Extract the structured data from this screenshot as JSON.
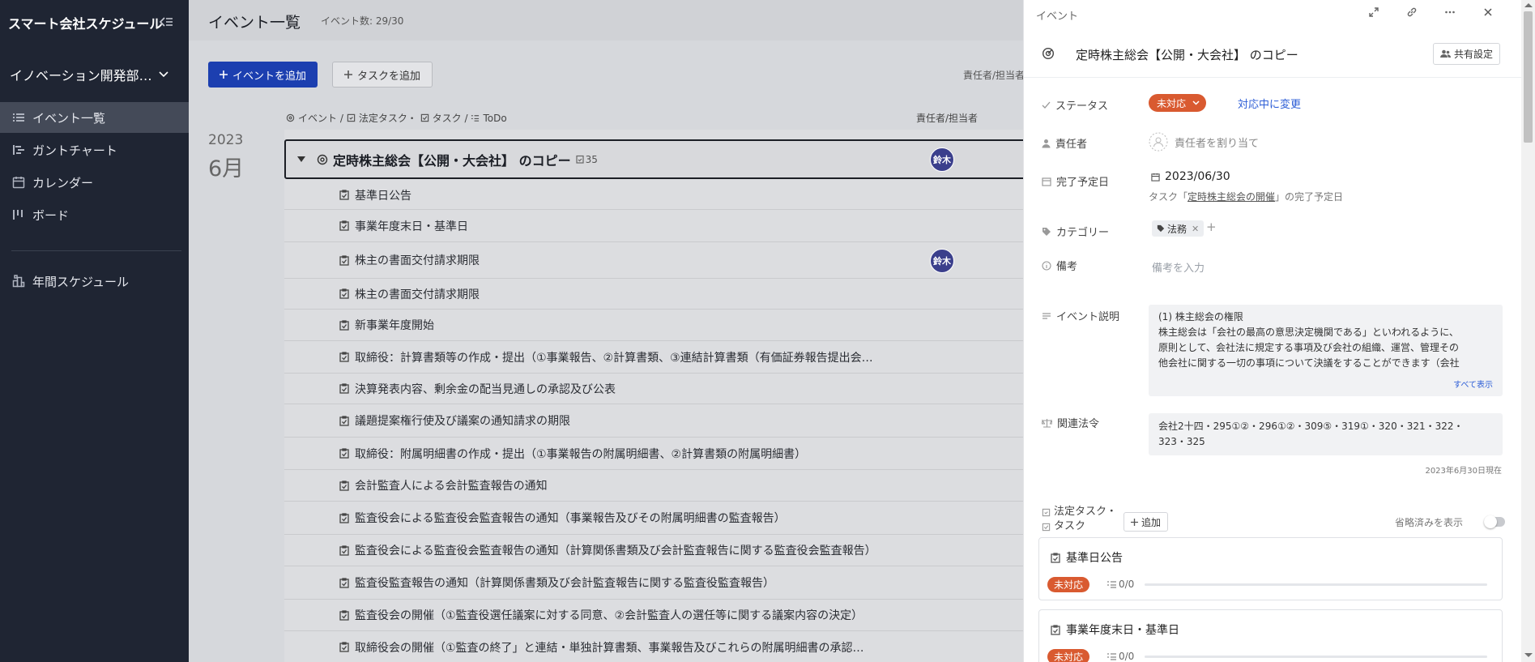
{
  "app": {
    "title": "スマート会社スケジュール",
    "org_name": "イノベーション開発部…"
  },
  "sidebar": {
    "items": [
      {
        "label": "イベント一覧",
        "icon": "list-icon",
        "active": true
      },
      {
        "label": "ガントチャート",
        "icon": "gantt-icon",
        "active": false
      },
      {
        "label": "カレンダー",
        "icon": "calendar-icon",
        "active": false
      },
      {
        "label": "ボード",
        "icon": "board-icon",
        "active": false
      },
      {
        "label": "年間スケジュール",
        "icon": "annual-schedule-icon",
        "active": false
      }
    ]
  },
  "main": {
    "title": "イベント一覧",
    "event_count": "イベント数: 29/30",
    "add_event_label": "イベントを追加",
    "add_task_label": "タスクを追加",
    "assignee_header_cut": "責任者/担当者",
    "list_header": {
      "event": "イベント /",
      "legal_task": "法定タスク・",
      "task": "タスク /",
      "todo": "ToDo",
      "assignee": "責任者/担当者"
    },
    "year": "2023",
    "month": "6月",
    "parent_event": {
      "title": "定時株主総会【公開・大会社】 のコピー",
      "count": "35",
      "avatar": "鈴木"
    },
    "tasks": [
      {
        "label": "基準日公告",
        "avatar": ""
      },
      {
        "label": "事業年度末日・基準日",
        "avatar": ""
      },
      {
        "label": "株主の書面交付請求期限",
        "avatar": "鈴木"
      },
      {
        "label": "株主の書面交付請求期限",
        "avatar": ""
      },
      {
        "label": "新事業年度開始",
        "avatar": ""
      },
      {
        "label": "取締役：計算書類等の作成・提出（①事業報告、②計算書類、③連結計算書類（有価証券報告提出会…",
        "avatar": ""
      },
      {
        "label": "決算発表内容、剰余金の配当見通しの承認及び公表",
        "avatar": ""
      },
      {
        "label": "議題提案権行使及び議案の通知請求の期限",
        "avatar": ""
      },
      {
        "label": "取締役：附属明細書の作成・提出（①事業報告の附属明細書、②計算書類の附属明細書）",
        "avatar": ""
      },
      {
        "label": "会計監査人による会計監査報告の通知",
        "avatar": ""
      },
      {
        "label": "監査役会による監査役会監査報告の通知（事業報告及びその附属明細書の監査報告）",
        "avatar": ""
      },
      {
        "label": "監査役会による監査役会監査報告の通知（計算関係書類及び会計監査報告に関する監査役会監査報告）",
        "avatar": ""
      },
      {
        "label": "監査役監査報告の通知（計算関係書類及び会計監査報告に関する監査役監査報告）",
        "avatar": ""
      },
      {
        "label": "監査役会の開催（①監査役選任議案に対する同意、②会計監査人の選任等に関する議案内容の決定）",
        "avatar": ""
      },
      {
        "label": "取締役会の開催（①監査の終了」と連結・単独計算書類、事業報告及びこれらの附属明細書の承認…",
        "avatar": ""
      }
    ]
  },
  "panel": {
    "label": "イベント",
    "title": "定時株主総会【公開・大会社】 のコピー",
    "share_label": "共有設定",
    "status_label": "ステータス",
    "status_value": "未対応",
    "status_link": "対応中に変更",
    "assignee_label": "責任者",
    "assignee_placeholder": "責任者を割り当て",
    "due_label": "完了予定日",
    "due_value": "2023/06/30",
    "due_note_prefix": "タスク「",
    "due_note_link": "定時株主総会の開催",
    "due_note_suffix": "」の完了予定日",
    "category_label": "カテゴリー",
    "category_value": "法務",
    "note_label": "備考",
    "note_placeholder": "備考を入力",
    "desc_label": "イベント説明",
    "desc_lines": [
      "(1) 株主総会の権限",
      "株主総会は「会社の最高の意思決定機関である」といわれるように、",
      "原則として、会社法に規定する事項及び会社の組織、運営、管理その",
      "他会社に関する一切の事項について決議をすることができます（会社"
    ],
    "desc_more": "すべて表示",
    "law_label": "関連法令",
    "law_line1": "会社2十四・295①②・296①②・309⑤・319①・320・321・322・",
    "law_line2": "323・325",
    "as_of": "2023年6月30日現在",
    "tasks_head_1": "法定タスク・",
    "tasks_head_2": "タスク",
    "add_label": "追加",
    "show_omitted": "省略済みを表示",
    "task_cards": [
      {
        "name": "基準日公告",
        "status": "未対応",
        "todo": "0/0",
        "progress": 0
      },
      {
        "name": "事業年度末日・基準日",
        "status": "未対応",
        "todo": "0/0",
        "progress": 0
      }
    ]
  },
  "colors": {
    "sidebar_bg": "#1f2533",
    "primary": "#1c3fb0",
    "status_badge": "#d95a30",
    "avatar": "#3b3f8c",
    "link": "#2c5dd6"
  }
}
